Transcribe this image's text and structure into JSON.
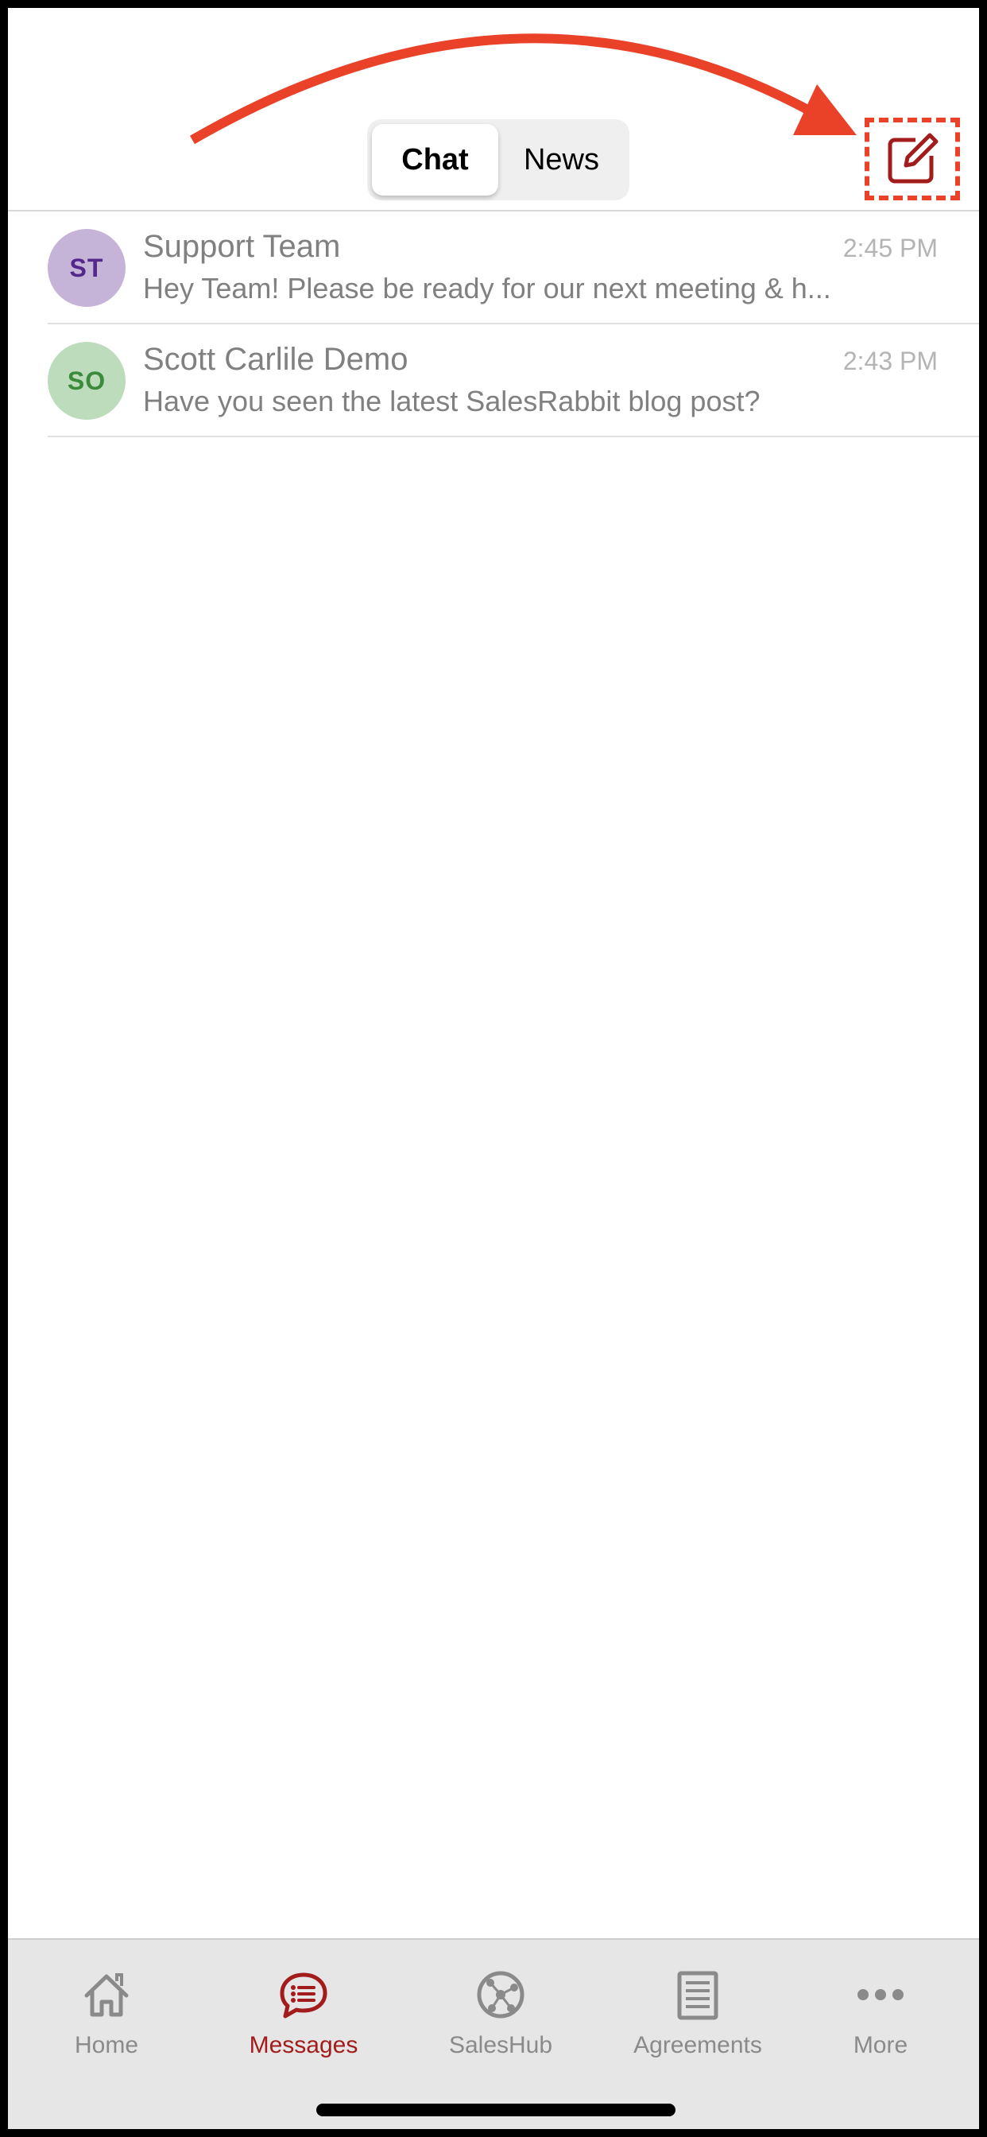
{
  "segmented": {
    "chat_label": "Chat",
    "news_label": "News",
    "selected": "Chat"
  },
  "icons": {
    "compose": "compose-icon",
    "annotation_arrow": "arrow-icon"
  },
  "colors": {
    "accent": "#a31c1c",
    "annotation": "#ea4129",
    "st_avatar_bg": "#c6b3d8",
    "st_avatar_text": "#52288a",
    "so_avatar_bg": "#bcdcbc",
    "so_avatar_text": "#3c8a3c"
  },
  "chats": [
    {
      "initials": "ST",
      "name": "Support Team",
      "time": "2:45 PM",
      "preview": "Hey Team! Please be ready for our next meeting & h..."
    },
    {
      "initials": "SO",
      "name": "Scott Carlile Demo",
      "time": "2:43 PM",
      "preview": "Have you seen the latest SalesRabbit blog post?"
    }
  ],
  "tabbar": {
    "items": [
      {
        "label": "Home",
        "icon": "home-icon"
      },
      {
        "label": "Messages",
        "icon": "messages-icon",
        "active": true
      },
      {
        "label": "SalesHub",
        "icon": "saleshub-icon"
      },
      {
        "label": "Agreements",
        "icon": "agreements-icon"
      },
      {
        "label": "More",
        "icon": "more-icon"
      }
    ]
  }
}
